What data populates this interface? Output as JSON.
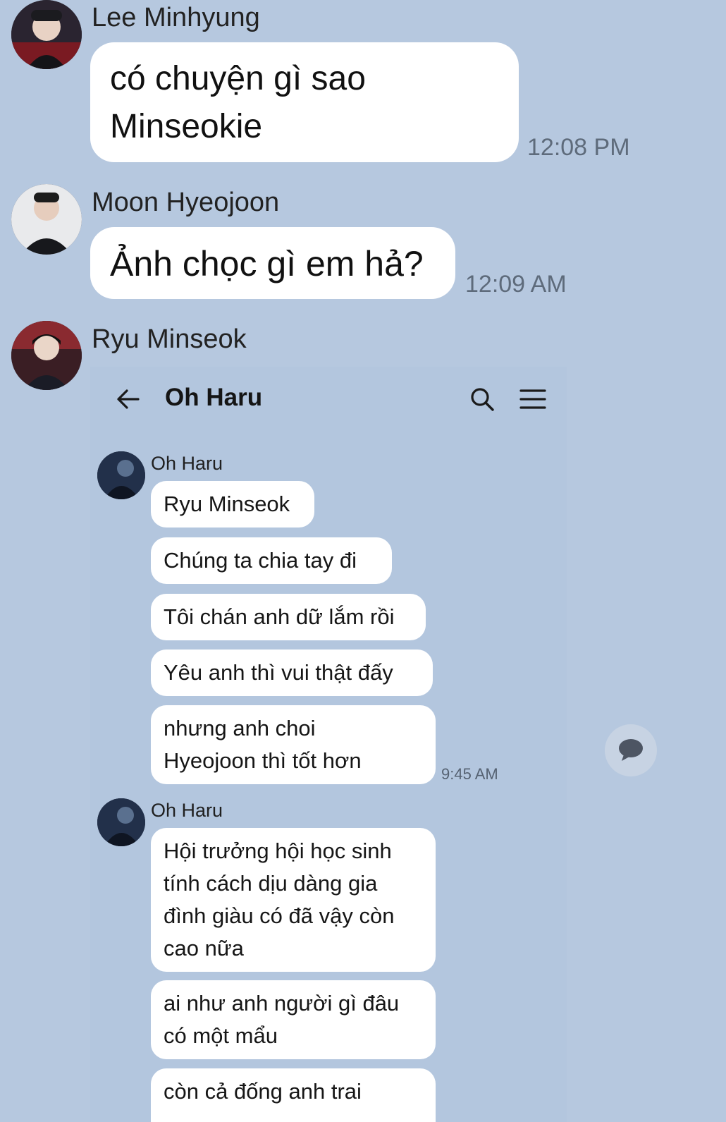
{
  "outer_chat": {
    "messages": [
      {
        "sender": "Lee Minhyung",
        "text_line1": "có chuyện gì sao",
        "text_line2": "Minseokie",
        "time": "12:08 PM"
      },
      {
        "sender": "Moon Hyeojoon",
        "text": "Ảnh chọc gì em hả?",
        "time": "12:09 AM"
      },
      {
        "sender": "Ryu Minseok"
      }
    ]
  },
  "shared_screenshot": {
    "header": {
      "back_icon": "arrow-left-icon",
      "title": "Oh Haru",
      "search_icon": "search-icon",
      "menu_icon": "hamburger-menu-icon"
    },
    "group1": {
      "sender": "Oh Haru",
      "bubbles": [
        "Ryu Minseok",
        "Chúng ta chia tay đi",
        "Tôi chán anh dữ lắm rồi",
        "Yêu anh thì vui thật đấy",
        [
          "nhưng anh choi",
          "Hyeojoon thì tốt hơn"
        ]
      ],
      "time": "9:45 AM"
    },
    "group2": {
      "sender": "Oh Haru",
      "bubbles": [
        [
          "Hội trưởng hội học sinh",
          "tính cách dịu dàng gia",
          "đình giàu có đã vậy còn",
          "cao nữa"
        ],
        [
          "ai như anh người gì đâu",
          "có một mẩu"
        ],
        [
          "còn cả đống anh trai"
        ]
      ]
    }
  },
  "floating_button": {
    "icon": "chat-bubble-icon"
  },
  "colors": {
    "background": "#b6c8df",
    "bubble": "#ffffff"
  }
}
